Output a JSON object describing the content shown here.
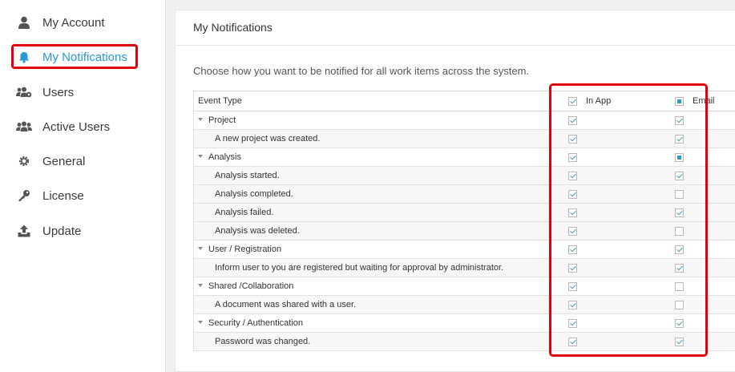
{
  "sidebar": {
    "items": [
      {
        "label": "My Account",
        "icon": "user-icon"
      },
      {
        "label": "My Notifications",
        "icon": "bell-icon",
        "active": true
      },
      {
        "label": "Users",
        "icon": "users-gear-icon"
      },
      {
        "label": "Active Users",
        "icon": "users-icon"
      },
      {
        "label": "General",
        "icon": "gear-icon"
      },
      {
        "label": "License",
        "icon": "key-icon"
      },
      {
        "label": "Update",
        "icon": "upload-icon"
      }
    ]
  },
  "panel": {
    "title": "My Notifications",
    "intro": "Choose how you want to be notified for all work items across the system."
  },
  "table": {
    "headers": {
      "event": "Event Type",
      "in_app": "In App",
      "email": "Email",
      "in_app_state": "checked",
      "email_state": "partial"
    },
    "rows": [
      {
        "label": "Project",
        "group": true,
        "in_app": "checked",
        "email": "checked"
      },
      {
        "label": "A new project was created.",
        "group": false,
        "in_app": "checked",
        "email": "checked"
      },
      {
        "label": "Analysis",
        "group": true,
        "in_app": "checked",
        "email": "partial"
      },
      {
        "label": "Analysis started.",
        "group": false,
        "in_app": "checked",
        "email": "checked"
      },
      {
        "label": "Analysis completed.",
        "group": false,
        "in_app": "checked",
        "email": "unchecked"
      },
      {
        "label": "Analysis failed.",
        "group": false,
        "in_app": "checked",
        "email": "checked"
      },
      {
        "label": "Analysis was deleted.",
        "group": false,
        "in_app": "checked",
        "email": "unchecked"
      },
      {
        "label": "User / Registration",
        "group": true,
        "in_app": "checked",
        "email": "checked"
      },
      {
        "label": "Inform user to you are registered but waiting for approval by administrator.",
        "group": false,
        "in_app": "checked",
        "email": "checked"
      },
      {
        "label": "Shared /Collaboration",
        "group": true,
        "in_app": "checked",
        "email": "unchecked"
      },
      {
        "label": "A document was shared with a user.",
        "group": false,
        "in_app": "checked",
        "email": "unchecked"
      },
      {
        "label": "Security / Authentication",
        "group": true,
        "in_app": "checked",
        "email": "checked"
      },
      {
        "label": "Password was changed.",
        "group": false,
        "in_app": "checked",
        "email": "checked"
      }
    ]
  },
  "colors": {
    "accent": "#2a98d6",
    "highlight": "#e0000e"
  }
}
